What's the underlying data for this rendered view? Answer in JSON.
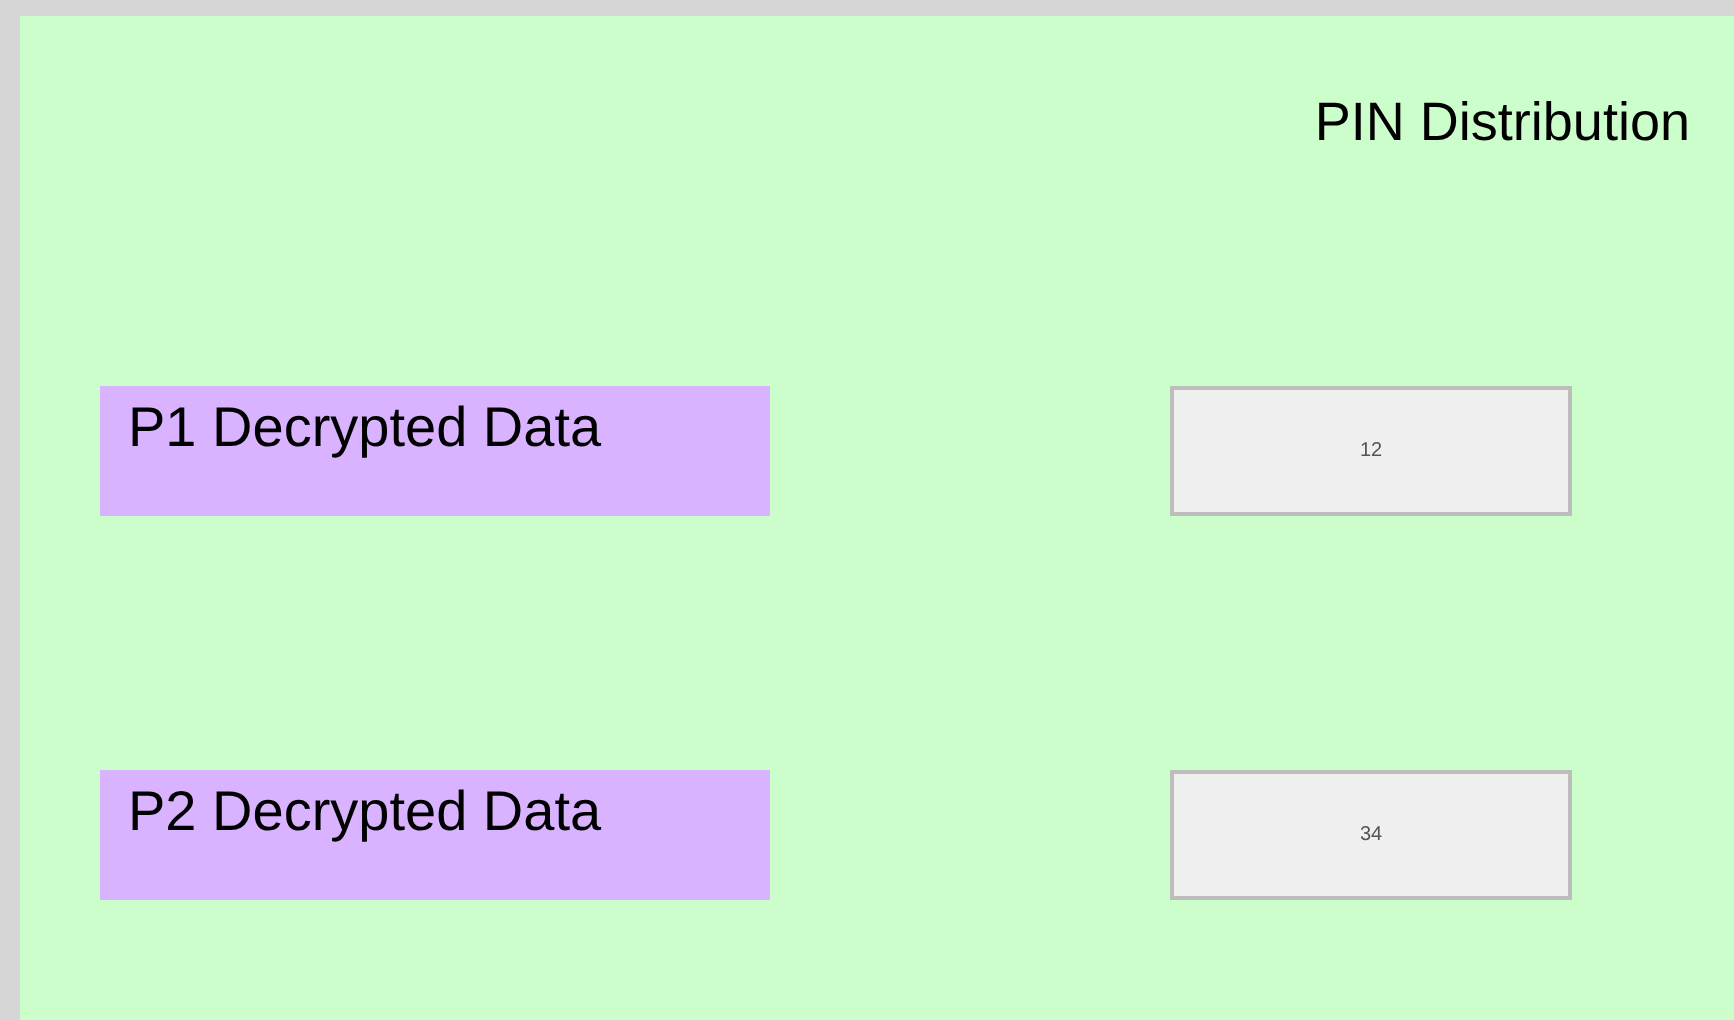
{
  "title": "PIN Distribution",
  "rows": [
    {
      "label": "P1 Decrypted Data",
      "value": "12"
    },
    {
      "label": "P2 Decrypted Data",
      "value": "34"
    }
  ]
}
